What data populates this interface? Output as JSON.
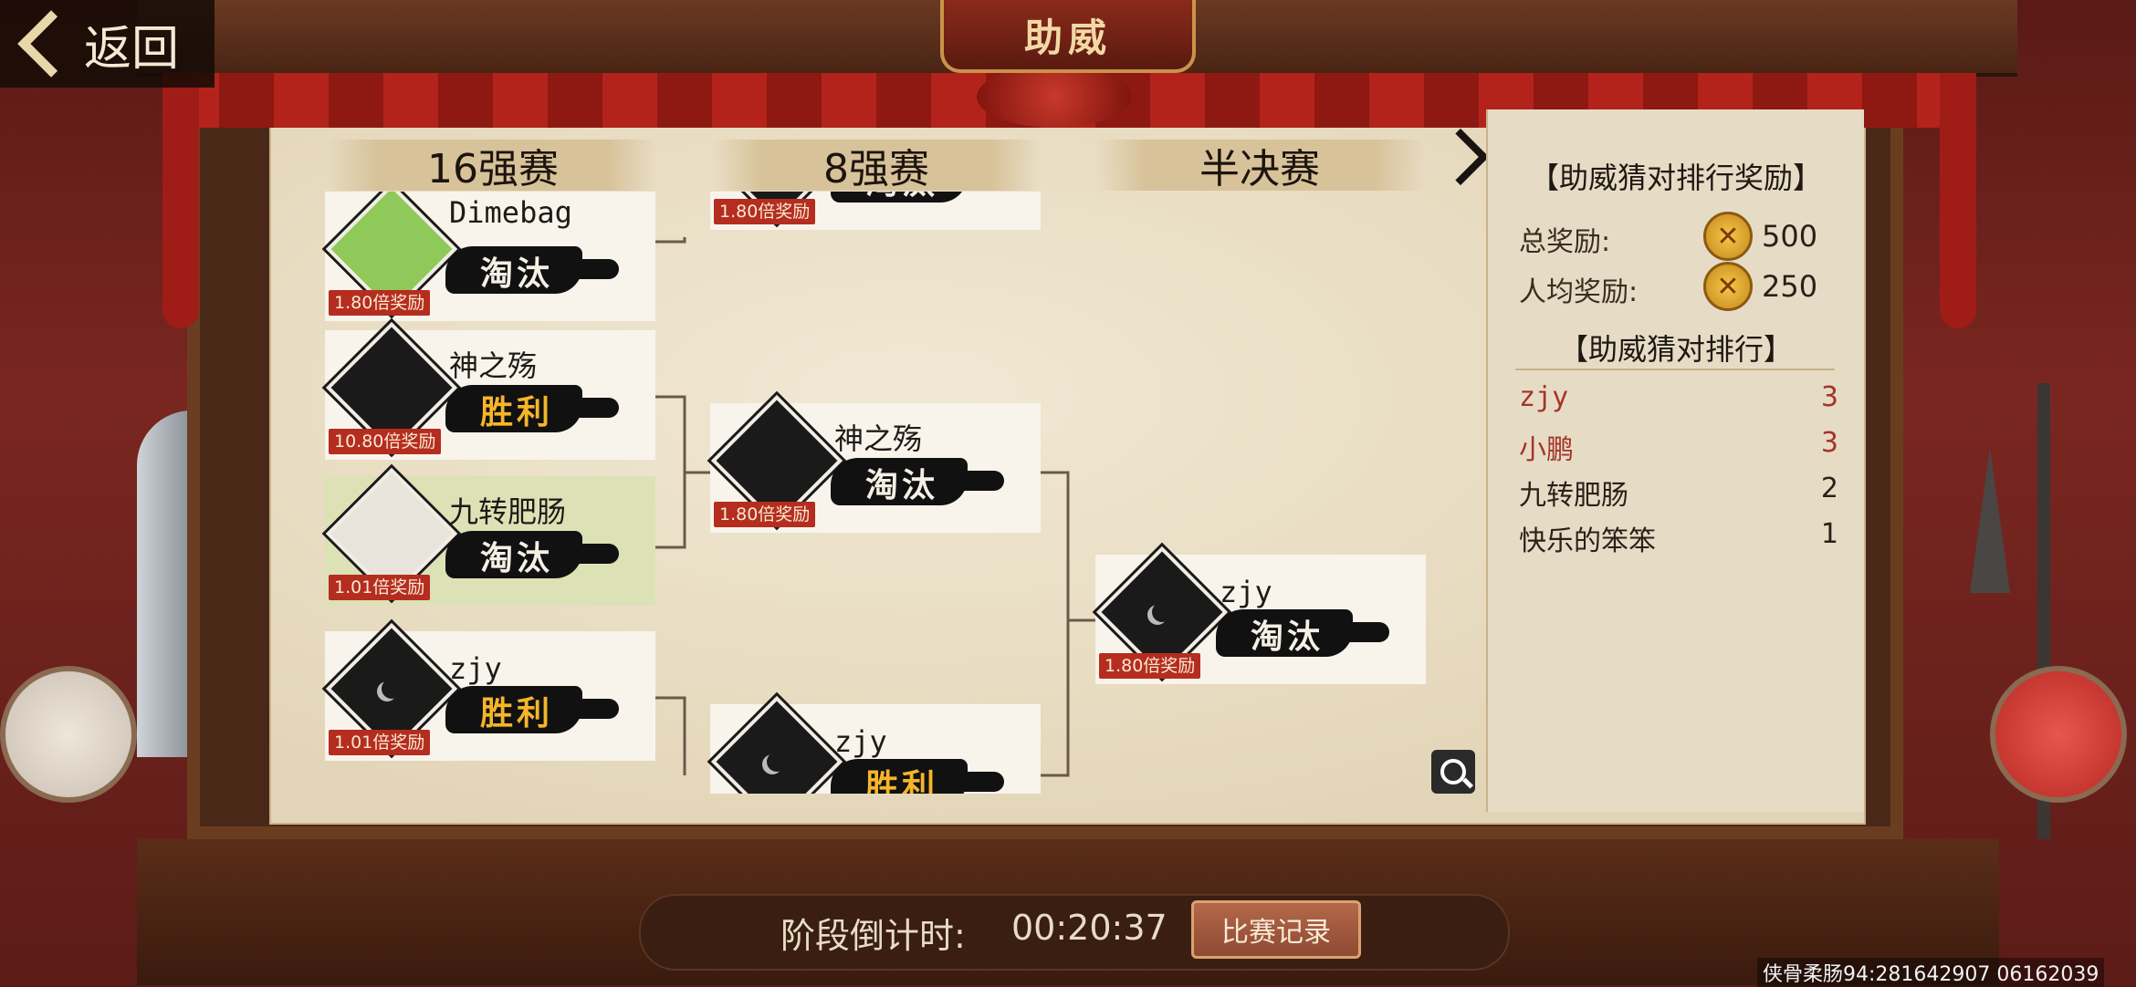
{
  "header": {
    "title": "助威",
    "back_label": "返回"
  },
  "rounds": {
    "r16": "16强赛",
    "r8": "8强赛",
    "semi": "半决赛"
  },
  "bracket": {
    "r16": [
      {
        "name": "Dimebag",
        "result": "淘汰",
        "odds": "1.80倍奖励",
        "highlight": false,
        "avatar": "frog"
      },
      {
        "name": "神之殇",
        "result": "胜利",
        "odds": "10.80倍奖励",
        "highlight": false,
        "avatar": "dark"
      },
      {
        "name": "九转肥肠",
        "result": "淘汰",
        "odds": "1.01倍奖励",
        "highlight": true,
        "avatar": "light"
      },
      {
        "name": "zjy",
        "result": "胜利",
        "odds": "1.01倍奖励",
        "highlight": false,
        "avatar": "moon"
      }
    ],
    "r8": [
      {
        "name": "",
        "result": "淘汰",
        "odds": "1.80倍奖励"
      },
      {
        "name": "神之殇",
        "result": "淘汰",
        "odds": "1.80倍奖励"
      },
      {
        "name": "zjy",
        "result": "胜利",
        "odds": ""
      }
    ],
    "semi": [
      {
        "name": "zjy",
        "result": "淘汰",
        "odds": "1.80倍奖励"
      }
    ]
  },
  "rewards": {
    "title": "【助威猜对排行奖励】",
    "total_label": "总奖励:",
    "total_value": "500",
    "per_label": "人均奖励:",
    "per_value": "250",
    "coin_icon": "coin-icon"
  },
  "ranking": {
    "title": "【助威猜对排行】",
    "rows": [
      {
        "name": "zjy",
        "score": "3",
        "color": "#a4342a"
      },
      {
        "name": "小鹏",
        "score": "3",
        "color": "#a4342a"
      },
      {
        "name": "九转肥肠",
        "score": "2",
        "color": "#2a2018"
      },
      {
        "name": "快乐的笨笨",
        "score": "1",
        "color": "#2a2018"
      }
    ]
  },
  "footer": {
    "countdown_label": "阶段倒计时:",
    "countdown_value": "00:20:37",
    "record_button": "比赛记录"
  },
  "watermark": "侠骨柔肠94:281642907 06162039"
}
